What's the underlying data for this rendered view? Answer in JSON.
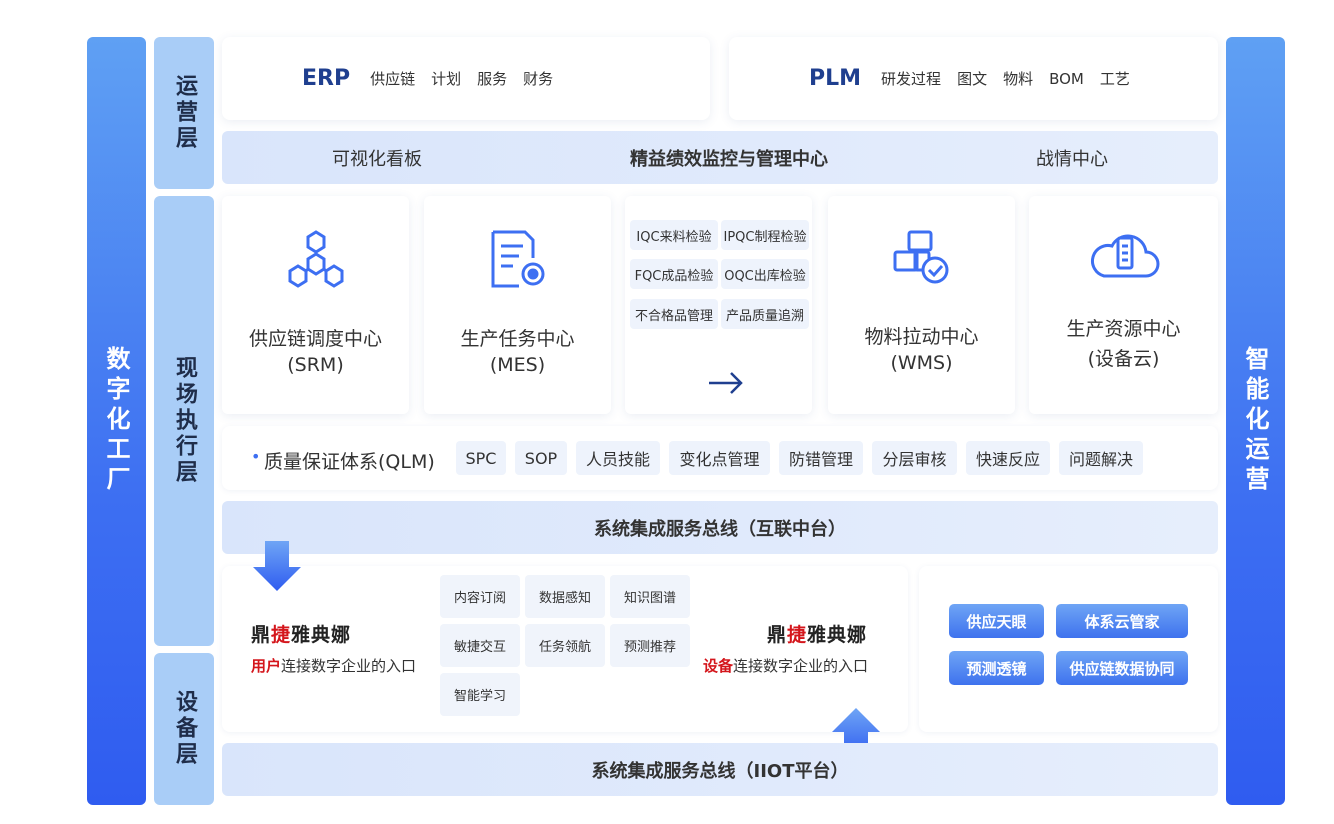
{
  "left_bar": "数字化工厂",
  "right_bar": "智能化运营",
  "layers": {
    "ops": "运营层",
    "exec": "现场执行层",
    "device": "设备层"
  },
  "erp": {
    "name": "ERP",
    "items": [
      "供应链",
      "计划",
      "服务",
      "财务"
    ]
  },
  "plm": {
    "name": "PLM",
    "items": [
      "研发过程",
      "图文",
      "物料",
      "BOM",
      "工艺"
    ]
  },
  "center_band": {
    "left": "可视化看板",
    "center": "精益绩效监控与管理中心",
    "right": "战情中心"
  },
  "modules": {
    "srm": {
      "title": "供应链调度中心",
      "sub": "(SRM)",
      "icon": "network-icon"
    },
    "mes": {
      "title": "生产任务中心",
      "sub": "(MES)",
      "icon": "document-gear-icon"
    },
    "wms": {
      "title": "物料拉动中心",
      "sub": "(WMS)",
      "icon": "boxes-check-icon"
    },
    "cloud": {
      "title": "生产资源中心",
      "sub": "(设备云)",
      "icon": "cloud-server-icon"
    }
  },
  "inspection": [
    "IQC来料检验",
    "IPQC制程检验",
    "FQC成品检验",
    "OQC出库检验",
    "不合格品管理",
    "产品质量追溯"
  ],
  "qlm": {
    "label": "质量保证体系(QLM)",
    "tags": [
      "SPC",
      "SOP",
      "人员技能",
      "变化点管理",
      "防错管理",
      "分层审核",
      "快速反应",
      "问题解决"
    ]
  },
  "bus_top": "系统集成服务总线（互联中台）",
  "bus_bottom": "系统集成服务总线（IIOT平台）",
  "brand": {
    "a": "鼎",
    "b": "捷",
    "c": "雅典娜"
  },
  "user_desc": {
    "hl": "用户",
    "rest": "连接数字企业的入口"
  },
  "device_desc": {
    "hl": "设备",
    "rest": "连接数字企业的入口"
  },
  "features": [
    "内容订阅",
    "数据感知",
    "知识图谱",
    "敏捷交互",
    "任务领航",
    "预测推荐",
    "智能学习"
  ],
  "buttons": [
    "供应天眼",
    "体系云管家",
    "预测透镜",
    "供应链数据协同"
  ],
  "colors": {
    "accent": "#3d6ff2",
    "brand_red": "#d4161c",
    "layer": "#a9cdf7"
  }
}
